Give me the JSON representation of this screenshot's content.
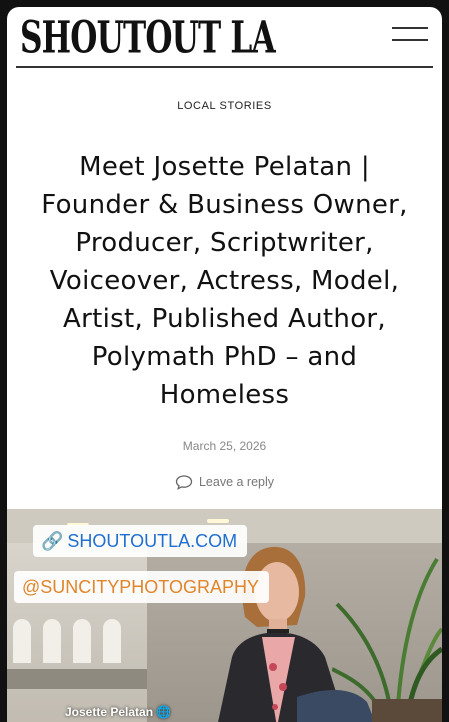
{
  "header": {
    "logo_text": "SHOUTOUT LA"
  },
  "article": {
    "category": "LOCAL STORIES",
    "title": "Meet Josette Pelatan | Founder & Business Owner, Producer, Scriptwriter, Voiceover, Actress, Model, Artist, Published Author, Polymath PhD – and Homeless",
    "date": "March 25, 2026",
    "reply_label": "Leave a reply"
  },
  "photo": {
    "site_tag": "SHOUTOUTLA.COM",
    "photographer_tag": "@SUNCITYPHOTOGRAPHY",
    "caption": "Josette Pelatan"
  },
  "colors": {
    "site_tag": "#1f6fd1",
    "photographer_tag": "#e0862a",
    "date": "#888888"
  },
  "icons": [
    "menu-icon",
    "comment-icon",
    "link-icon",
    "globe-icon"
  ]
}
